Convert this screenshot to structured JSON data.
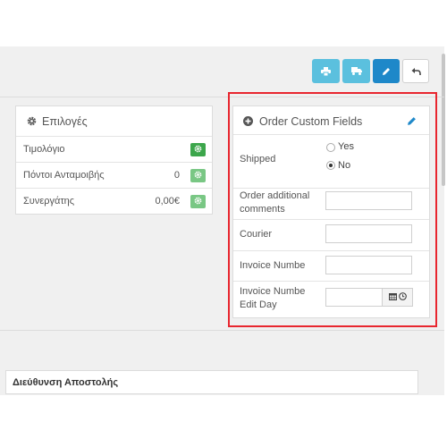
{
  "toolbar": {
    "buttons": [
      {
        "icon": "print-icon",
        "color": "#5bc0de"
      },
      {
        "icon": "truck-icon",
        "color": "#5bc0de"
      },
      {
        "icon": "pencil-icon",
        "color": "#1e88c9"
      },
      {
        "icon": "undo-icon",
        "color": "#ffffff"
      }
    ]
  },
  "options_panel": {
    "title": "Επιλογές",
    "icon": "gear-icon",
    "rows": [
      {
        "label": "Τιμολόγιο",
        "value": "",
        "button_icon": "gear-icon",
        "button_color": "#3ca64b"
      },
      {
        "label": "Πόντοι Ανταμοιβής",
        "value": "0",
        "button_icon": "gear-icon",
        "button_color": "#79c784"
      },
      {
        "label": "Συνεργάτης",
        "value": "0,00€",
        "button_icon": "gear-icon",
        "button_color": "#79c784"
      }
    ]
  },
  "custom_fields": {
    "title": "Order Custom Fields",
    "title_icon": "plus-circle-icon",
    "edit_icon": "pencil-icon",
    "highlight_color": "#e8262f",
    "shipped": {
      "label": "Shipped",
      "options": [
        "Yes",
        "No"
      ],
      "selected": "No"
    },
    "comments": {
      "label_line1": "Order additional",
      "label_line2": "comments",
      "value": ""
    },
    "courier": {
      "label": "Courier",
      "value": ""
    },
    "invoice_number": {
      "label": "Invoice Numbe",
      "value": ""
    },
    "invoice_edit_day": {
      "label_line1": "Invoice Numbe",
      "label_line2": "Edit Day",
      "value": "",
      "addon_icons": [
        "calendar-icon",
        "clock-icon"
      ]
    }
  },
  "table": {
    "columns": [
      "Διεύθυνση Αποστολής"
    ]
  }
}
